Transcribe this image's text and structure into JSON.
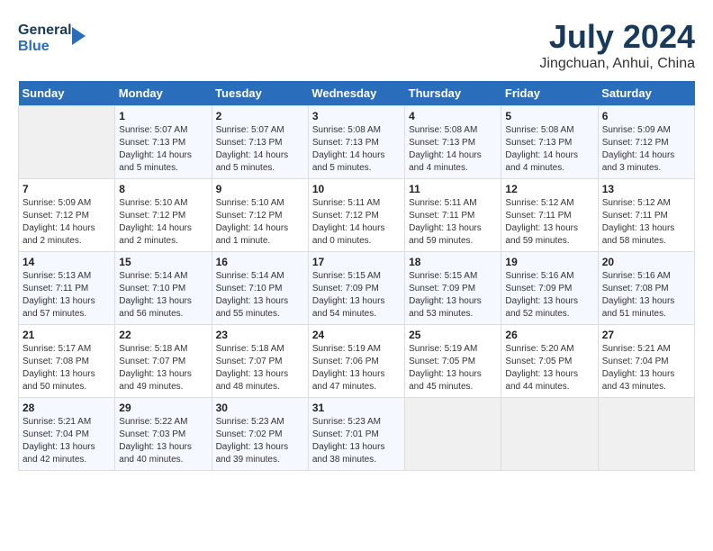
{
  "header": {
    "logo_line1": "General",
    "logo_line2": "Blue",
    "month": "July 2024",
    "location": "Jingchuan, Anhui, China"
  },
  "columns": [
    "Sunday",
    "Monday",
    "Tuesday",
    "Wednesday",
    "Thursday",
    "Friday",
    "Saturday"
  ],
  "weeks": [
    [
      {
        "day": "",
        "info": ""
      },
      {
        "day": "1",
        "info": "Sunrise: 5:07 AM\nSunset: 7:13 PM\nDaylight: 14 hours\nand 5 minutes."
      },
      {
        "day": "2",
        "info": "Sunrise: 5:07 AM\nSunset: 7:13 PM\nDaylight: 14 hours\nand 5 minutes."
      },
      {
        "day": "3",
        "info": "Sunrise: 5:08 AM\nSunset: 7:13 PM\nDaylight: 14 hours\nand 5 minutes."
      },
      {
        "day": "4",
        "info": "Sunrise: 5:08 AM\nSunset: 7:13 PM\nDaylight: 14 hours\nand 4 minutes."
      },
      {
        "day": "5",
        "info": "Sunrise: 5:08 AM\nSunset: 7:13 PM\nDaylight: 14 hours\nand 4 minutes."
      },
      {
        "day": "6",
        "info": "Sunrise: 5:09 AM\nSunset: 7:12 PM\nDaylight: 14 hours\nand 3 minutes."
      }
    ],
    [
      {
        "day": "7",
        "info": "Sunrise: 5:09 AM\nSunset: 7:12 PM\nDaylight: 14 hours\nand 2 minutes."
      },
      {
        "day": "8",
        "info": "Sunrise: 5:10 AM\nSunset: 7:12 PM\nDaylight: 14 hours\nand 2 minutes."
      },
      {
        "day": "9",
        "info": "Sunrise: 5:10 AM\nSunset: 7:12 PM\nDaylight: 14 hours\nand 1 minute."
      },
      {
        "day": "10",
        "info": "Sunrise: 5:11 AM\nSunset: 7:12 PM\nDaylight: 14 hours\nand 0 minutes."
      },
      {
        "day": "11",
        "info": "Sunrise: 5:11 AM\nSunset: 7:11 PM\nDaylight: 13 hours\nand 59 minutes."
      },
      {
        "day": "12",
        "info": "Sunrise: 5:12 AM\nSunset: 7:11 PM\nDaylight: 13 hours\nand 59 minutes."
      },
      {
        "day": "13",
        "info": "Sunrise: 5:12 AM\nSunset: 7:11 PM\nDaylight: 13 hours\nand 58 minutes."
      }
    ],
    [
      {
        "day": "14",
        "info": "Sunrise: 5:13 AM\nSunset: 7:11 PM\nDaylight: 13 hours\nand 57 minutes."
      },
      {
        "day": "15",
        "info": "Sunrise: 5:14 AM\nSunset: 7:10 PM\nDaylight: 13 hours\nand 56 minutes."
      },
      {
        "day": "16",
        "info": "Sunrise: 5:14 AM\nSunset: 7:10 PM\nDaylight: 13 hours\nand 55 minutes."
      },
      {
        "day": "17",
        "info": "Sunrise: 5:15 AM\nSunset: 7:09 PM\nDaylight: 13 hours\nand 54 minutes."
      },
      {
        "day": "18",
        "info": "Sunrise: 5:15 AM\nSunset: 7:09 PM\nDaylight: 13 hours\nand 53 minutes."
      },
      {
        "day": "19",
        "info": "Sunrise: 5:16 AM\nSunset: 7:09 PM\nDaylight: 13 hours\nand 52 minutes."
      },
      {
        "day": "20",
        "info": "Sunrise: 5:16 AM\nSunset: 7:08 PM\nDaylight: 13 hours\nand 51 minutes."
      }
    ],
    [
      {
        "day": "21",
        "info": "Sunrise: 5:17 AM\nSunset: 7:08 PM\nDaylight: 13 hours\nand 50 minutes."
      },
      {
        "day": "22",
        "info": "Sunrise: 5:18 AM\nSunset: 7:07 PM\nDaylight: 13 hours\nand 49 minutes."
      },
      {
        "day": "23",
        "info": "Sunrise: 5:18 AM\nSunset: 7:07 PM\nDaylight: 13 hours\nand 48 minutes."
      },
      {
        "day": "24",
        "info": "Sunrise: 5:19 AM\nSunset: 7:06 PM\nDaylight: 13 hours\nand 47 minutes."
      },
      {
        "day": "25",
        "info": "Sunrise: 5:19 AM\nSunset: 7:05 PM\nDaylight: 13 hours\nand 45 minutes."
      },
      {
        "day": "26",
        "info": "Sunrise: 5:20 AM\nSunset: 7:05 PM\nDaylight: 13 hours\nand 44 minutes."
      },
      {
        "day": "27",
        "info": "Sunrise: 5:21 AM\nSunset: 7:04 PM\nDaylight: 13 hours\nand 43 minutes."
      }
    ],
    [
      {
        "day": "28",
        "info": "Sunrise: 5:21 AM\nSunset: 7:04 PM\nDaylight: 13 hours\nand 42 minutes."
      },
      {
        "day": "29",
        "info": "Sunrise: 5:22 AM\nSunset: 7:03 PM\nDaylight: 13 hours\nand 40 minutes."
      },
      {
        "day": "30",
        "info": "Sunrise: 5:23 AM\nSunset: 7:02 PM\nDaylight: 13 hours\nand 39 minutes."
      },
      {
        "day": "31",
        "info": "Sunrise: 5:23 AM\nSunset: 7:01 PM\nDaylight: 13 hours\nand 38 minutes."
      },
      {
        "day": "",
        "info": ""
      },
      {
        "day": "",
        "info": ""
      },
      {
        "day": "",
        "info": ""
      }
    ]
  ]
}
